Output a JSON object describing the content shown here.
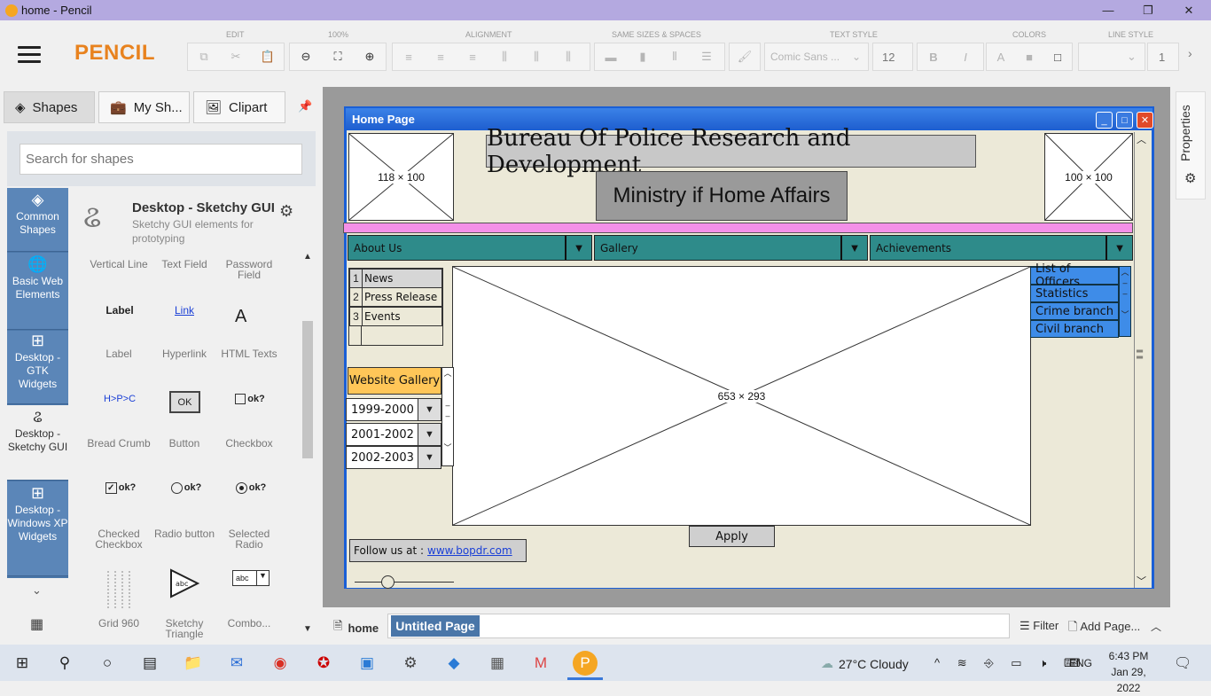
{
  "window": {
    "title": "home - Pencil",
    "min": "—",
    "max": "❐",
    "close": "✕"
  },
  "app": {
    "brand": "PENCIL"
  },
  "toolbar": {
    "groups": [
      "EDIT",
      "100%",
      "ALIGNMENT",
      "SAME SIZES & SPACES",
      "TEXT STYLE",
      "COLORS",
      "LINE STYLE"
    ],
    "font_name": "Comic Sans ...",
    "font_size": "12",
    "line_width": "1"
  },
  "left_tabs": [
    "Shapes",
    "My Sh...",
    "Clipart"
  ],
  "search": {
    "placeholder": "Search for shapes"
  },
  "categories": [
    {
      "label": "Common Shapes",
      "icon": "layers-icon"
    },
    {
      "label": "Basic Web Elements",
      "icon": "globe-icon"
    },
    {
      "label": "Desktop - GTK Widgets",
      "icon": "grid-icon"
    },
    {
      "label": "Desktop - Sketchy GUI",
      "icon": "squiggle-icon"
    },
    {
      "label": "Desktop - Windows XP Widgets",
      "icon": "grid-icon"
    }
  ],
  "collection": {
    "title": "Desktop - Sketchy GUI",
    "subtitle": "Sketchy GUI elements for prototyping"
  },
  "shapes": [
    {
      "label": "Vertical Line",
      "preview": ""
    },
    {
      "label": "Text Field",
      "preview": ""
    },
    {
      "label": "Password Field",
      "preview": ""
    },
    {
      "label": "Label",
      "preview": "Label"
    },
    {
      "label": "Hyperlink",
      "preview": "Link"
    },
    {
      "label": "HTML Texts",
      "preview": "A"
    },
    {
      "label": "Bread Crumb",
      "preview": "H>P>C"
    },
    {
      "label": "Button",
      "preview": "OK"
    },
    {
      "label": "Checkbox",
      "preview": "ok?"
    },
    {
      "label": "Checked Checkbox",
      "preview": "ok?"
    },
    {
      "label": "Radio button",
      "preview": "ok?"
    },
    {
      "label": "Selected Radio",
      "preview": "ok?"
    },
    {
      "label": "Grid 960",
      "preview": ""
    },
    {
      "label": "Sketchy Triangle",
      "preview": "abc"
    },
    {
      "label": "Combo...",
      "preview": "abc"
    }
  ],
  "mockup": {
    "window_title": "Home Page",
    "logo_left": "118 × 100",
    "logo_right": "100 × 100",
    "heading1": "Bureau Of Police Research and Development",
    "heading2": "Ministry if Home Affairs",
    "menus": [
      "About Us",
      "Gallery",
      "Achievements"
    ],
    "list": [
      {
        "num": "1",
        "text": "News"
      },
      {
        "num": "2",
        "text": "Press Release"
      },
      {
        "num": "3",
        "text": "Events"
      }
    ],
    "main_image": "653 × 293",
    "box_list": [
      "List of Officers",
      "Statistics",
      "Crime branch",
      "Civil branch"
    ],
    "gallery_button": "Website Gallery",
    "years": [
      "1999-2000",
      "2001-2002",
      "2002-2003"
    ],
    "apply": "Apply",
    "follow_text": "Follow us at :",
    "follow_link": "www.bopdr.com"
  },
  "pages": {
    "home": "home",
    "current": "Untitled Page",
    "filter": "Filter",
    "add_page": "Add Page..."
  },
  "right_panel": {
    "label": "Properties"
  },
  "taskbar": {
    "weather": "27°C  Cloudy",
    "lang": "ENG",
    "time": "6:43 PM",
    "date": "Jan 29, 2022"
  }
}
